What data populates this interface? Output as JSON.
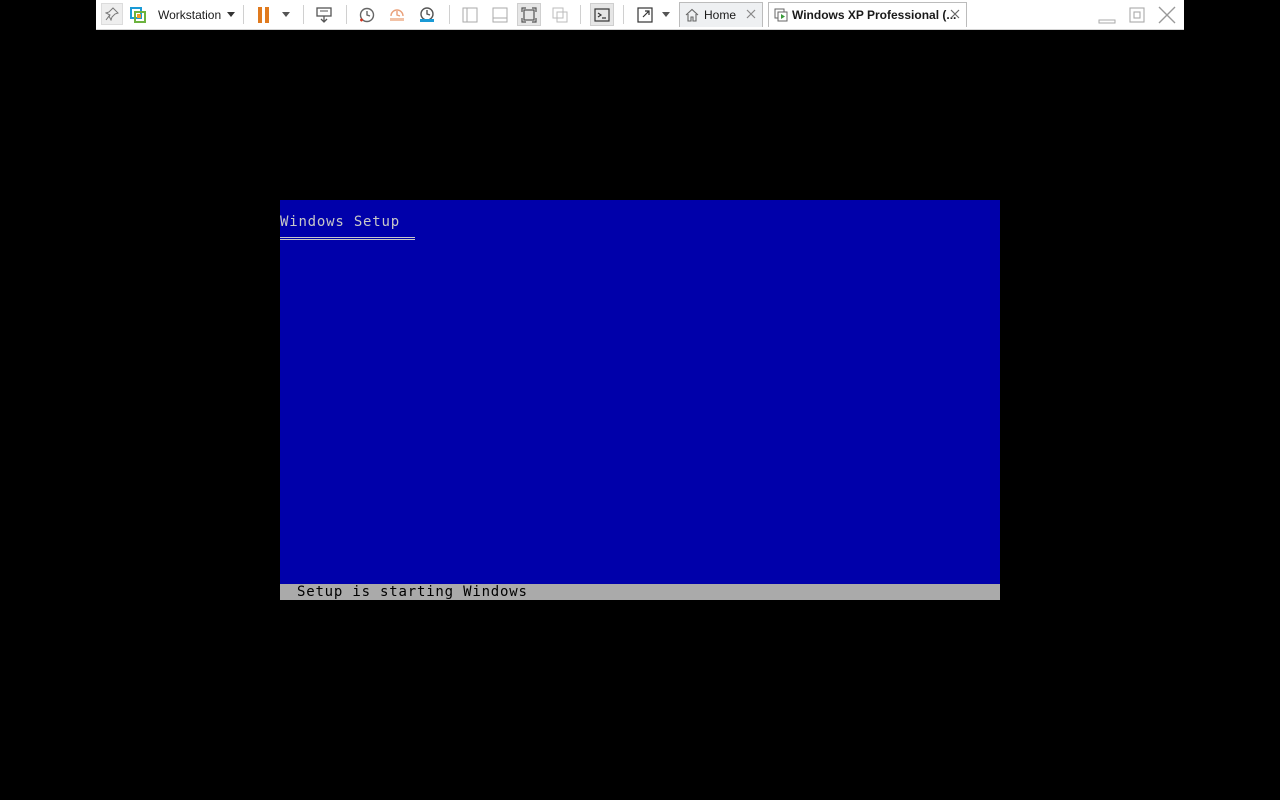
{
  "toolbar": {
    "product_label": "Workstation",
    "tabs": [
      {
        "label": "Home"
      },
      {
        "label": "Windows XP Professional (..."
      }
    ],
    "icons": [
      "pin-icon",
      "workstation-logo-icon",
      "chevron-down-icon",
      "pause-icon",
      "send-ctrl-alt-del-icon",
      "snapshot-icon",
      "revert-snapshot-icon",
      "snapshot-manager-icon",
      "library-icon",
      "thumbnail-icon",
      "fit-window-icon",
      "unity-icon",
      "console-icon",
      "full-screen-icon",
      "home-icon",
      "vm-tab-icon",
      "close-icon",
      "minimize-icon",
      "restore-icon"
    ],
    "accent_color": "#e07a1e"
  },
  "console": {
    "title": "Windows Setup",
    "status": "Setup is starting Windows",
    "background_color": "#0000aa",
    "status_bar_color": "#aaaaaa"
  }
}
